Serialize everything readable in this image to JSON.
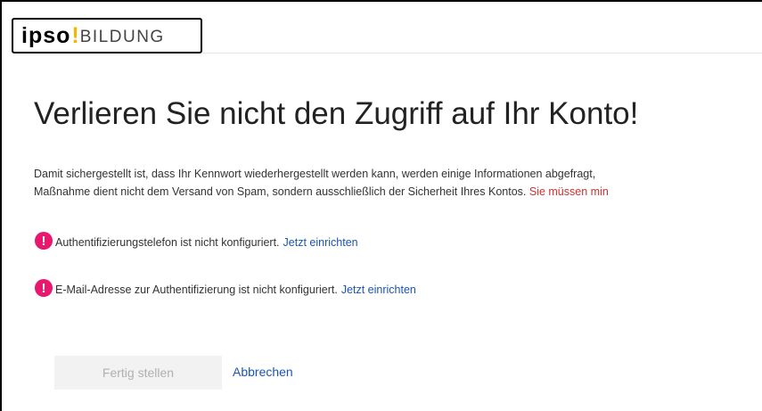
{
  "logo": {
    "part1": "ipso",
    "part2": "!",
    "part3": "BILDUNG"
  },
  "heading": "Verlieren Sie nicht den Zugriff auf Ihr Konto!",
  "intro": {
    "line1": "Damit sichergestellt ist, dass Ihr Kennwort wiederhergestellt werden kann, werden einige Informationen abgefragt,",
    "line2_start": "Maßnahme dient nicht dem Versand von Spam, sondern ausschließlich der Sicherheit Ihres Kontos. ",
    "line2_warning": "Sie müssen min"
  },
  "items": [
    {
      "icon": "alert-icon",
      "glyph": "!",
      "text": "Authentifizierungstelefon ist nicht konfiguriert.",
      "link": "Jetzt einrichten"
    },
    {
      "icon": "alert-icon",
      "glyph": "!",
      "text": "E-Mail-Adresse zur Authentifizierung ist nicht konfiguriert.",
      "link": "Jetzt einrichten"
    }
  ],
  "buttons": {
    "finish": "Fertig stellen",
    "cancel": "Abbrechen"
  },
  "colors": {
    "alert_icon": "#e8186f",
    "link": "#1a55b3",
    "warning_text": "#d03030",
    "logo_accent": "#f5b400"
  }
}
